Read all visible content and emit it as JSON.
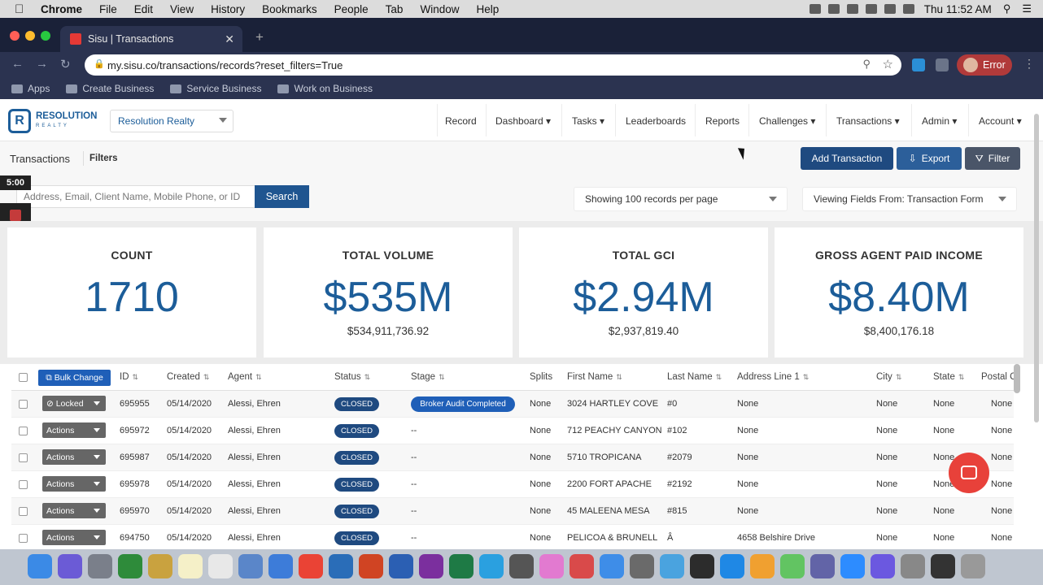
{
  "menubar": {
    "app": "Chrome",
    "items": [
      "File",
      "Edit",
      "View",
      "History",
      "Bookmarks",
      "People",
      "Tab",
      "Window",
      "Help"
    ],
    "clock": "Thu 11:52 AM"
  },
  "browser": {
    "tab_title": "Sisu | Transactions",
    "url": "my.sisu.co/transactions/records?reset_filters=True",
    "profile_label": "Error",
    "bookmarks": [
      "Apps",
      "Create Business",
      "Service Business",
      "Work on Business"
    ]
  },
  "nav": {
    "company": "Resolution Realty",
    "logo_name": "RESOLUTION",
    "logo_sub": "REALTY",
    "items": [
      "Record",
      "Dashboard ▾",
      "Tasks ▾",
      "Leaderboards",
      "Reports",
      "Challenges ▾",
      "Transactions ▾",
      "Admin ▾",
      "Account ▾"
    ]
  },
  "header": {
    "title": "Transactions",
    "filters_link": "Filters",
    "add_button": "Add Transaction",
    "export_button": "Export",
    "filter_button": "Filter"
  },
  "overlay": {
    "timer": "5:00"
  },
  "search": {
    "placeholder": "Address, Email, Client Name, Mobile Phone, or ID",
    "button": "Search"
  },
  "selects": {
    "per_page": "Showing 100 records per page",
    "fields": "Viewing Fields From: Transaction Form"
  },
  "stats": [
    {
      "label": "COUNT",
      "big": "1710",
      "small": ""
    },
    {
      "label": "TOTAL VOLUME",
      "big": "$535M",
      "small": "$534,911,736.92"
    },
    {
      "label": "TOTAL GCI",
      "big": "$2.94M",
      "small": "$2,937,819.40"
    },
    {
      "label": "GROSS AGENT PAID INCOME",
      "big": "$8.40M",
      "small": "$8,400,176.18"
    }
  ],
  "table": {
    "bulk_button": "Bulk Change",
    "columns": [
      "ID",
      "Created",
      "Agent",
      "Status",
      "Stage",
      "Splits",
      "First Name",
      "Last Name",
      "Address Line 1",
      "City",
      "State",
      "Postal C"
    ],
    "rows": [
      {
        "action": "⊘ Locked",
        "id": "695955",
        "created": "05/14/2020",
        "agent": "Alessi, Ehren",
        "status": "CLOSED",
        "stage": "Broker Audit Completed",
        "splits": "None",
        "first": "3024 HARTLEY COVE",
        "last": "#0",
        "addr": "None",
        "city": "None",
        "state": "None",
        "postal": "None"
      },
      {
        "action": "Actions",
        "id": "695972",
        "created": "05/14/2020",
        "agent": "Alessi, Ehren",
        "status": "CLOSED",
        "stage": "--",
        "splits": "None",
        "first": "712 PEACHY CANYON",
        "last": "#102",
        "addr": "None",
        "city": "None",
        "state": "None",
        "postal": "None"
      },
      {
        "action": "Actions",
        "id": "695987",
        "created": "05/14/2020",
        "agent": "Alessi, Ehren",
        "status": "CLOSED",
        "stage": "--",
        "splits": "None",
        "first": "5710 TROPICANA",
        "last": "#2079",
        "addr": "None",
        "city": "None",
        "state": "None",
        "postal": "None"
      },
      {
        "action": "Actions",
        "id": "695978",
        "created": "05/14/2020",
        "agent": "Alessi, Ehren",
        "status": "CLOSED",
        "stage": "--",
        "splits": "None",
        "first": "2200 FORT APACHE",
        "last": "#2192",
        "addr": "None",
        "city": "None",
        "state": "None",
        "postal": "None"
      },
      {
        "action": "Actions",
        "id": "695970",
        "created": "05/14/2020",
        "agent": "Alessi, Ehren",
        "status": "CLOSED",
        "stage": "--",
        "splits": "None",
        "first": "45 MALEENA MESA",
        "last": "#815",
        "addr": "None",
        "city": "None",
        "state": "None",
        "postal": "None"
      },
      {
        "action": "Actions",
        "id": "694750",
        "created": "05/14/2020",
        "agent": "Alessi, Ehren",
        "status": "CLOSED",
        "stage": "--",
        "splits": "None",
        "first": "PELICOA & BRUNELL",
        "last": "Â",
        "addr": "4658 Belshire Drive",
        "city": "None",
        "state": "None",
        "postal": "None"
      }
    ]
  }
}
